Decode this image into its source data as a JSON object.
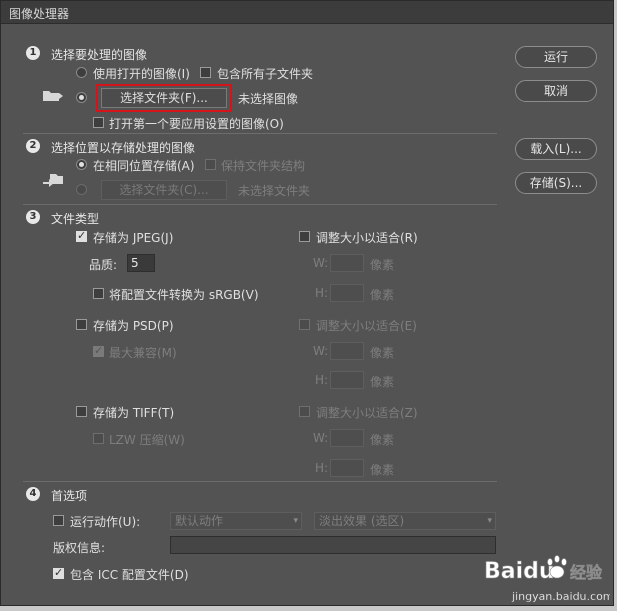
{
  "window": {
    "title": "图像处理器"
  },
  "buttons": {
    "run": "运行",
    "cancel": "取消",
    "load": "载入(L)...",
    "save": "存储(S)..."
  },
  "section1": {
    "num": "1",
    "title": "选择要处理的图像",
    "use_open": "使用打开的图像(I)",
    "include_subfolders": "包含所有子文件夹",
    "select_folder_button": "选择文件夹(F)...",
    "folder_status": "未选择图像",
    "open_first": "打开第一个要应用设置的图像(O)"
  },
  "section2": {
    "num": "2",
    "title": "选择位置以存储处理的图像",
    "same_location": "在相同位置存储(A)",
    "keep_structure": "保持文件夹结构",
    "select_folder_button": "选择文件夹(C)...",
    "folder_status": "未选择文件夹"
  },
  "section3": {
    "num": "3",
    "title": "文件类型",
    "jpeg": {
      "save_as": "存储为 JPEG(J)",
      "checked": true,
      "resize": "调整大小以适合(R)",
      "quality_label": "品质:",
      "quality_value": "5",
      "convert_srgb": "将配置文件转换为 sRGB(V)",
      "w_label": "W:",
      "h_label": "H:",
      "unit": "像素"
    },
    "psd": {
      "save_as": "存储为 PSD(P)",
      "checked": false,
      "resize": "调整大小以适合(E)",
      "max_compat": "最大兼容(M)",
      "w_label": "W:",
      "h_label": "H:",
      "unit": "像素"
    },
    "tiff": {
      "save_as": "存储为 TIFF(T)",
      "checked": false,
      "resize": "调整大小以适合(Z)",
      "lzw": "LZW 压缩(W)",
      "w_label": "W:",
      "h_label": "H:",
      "unit": "像素"
    }
  },
  "section4": {
    "num": "4",
    "title": "首选项",
    "run_action": "运行动作(U):",
    "action_set": "默认动作",
    "action": "淡出效果 (选区)",
    "copyright": "版权信息:",
    "include_icc": "包含 ICC 配置文件(D)"
  },
  "watermark": {
    "brand": "Baidu",
    "sub": "经验",
    "url": "jingyan.baidu.com"
  },
  "colors": {
    "dialog_bg": "#535353",
    "highlight": "#d4141a"
  }
}
